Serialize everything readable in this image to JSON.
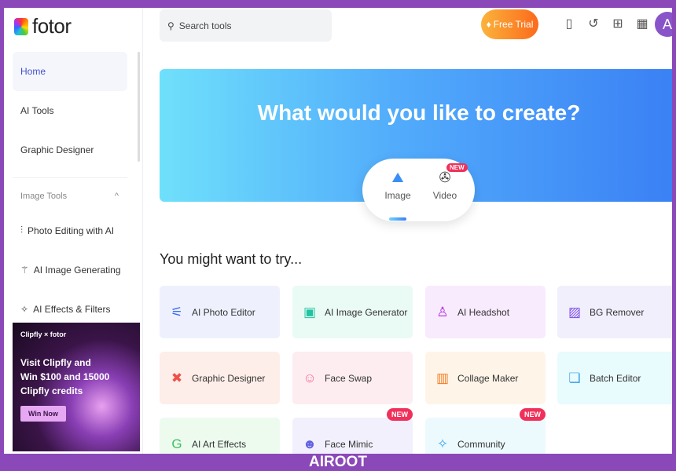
{
  "logo": "fotor",
  "sidebar": {
    "items": [
      {
        "label": "Home",
        "active": true
      },
      {
        "label": "AI Tools"
      },
      {
        "label": "Graphic Designer"
      }
    ],
    "section": "Image Tools",
    "sub_items": [
      {
        "label": "Photo Editing with AI",
        "icon": "sliders-icon"
      },
      {
        "label": "AI Image Generating",
        "icon": "magic-wand-icon"
      },
      {
        "label": "AI Effects & Filters",
        "icon": "effects-icon"
      }
    ],
    "banner": {
      "brand": "Clipfly × fotor",
      "line1": "Visit Clipfly and",
      "line2": "Win $100 and 15000",
      "line3": "Clipfly credits",
      "button": "Win Now"
    }
  },
  "header": {
    "search_placeholder": "Search tools",
    "free_trial": "Free Trial",
    "avatar": "A"
  },
  "hero": {
    "title": "What would you like to create?",
    "tabs": [
      {
        "label": "Image",
        "active": true
      },
      {
        "label": "Video",
        "badge": "NEW"
      }
    ]
  },
  "section_title": "You might want to try...",
  "cards": [
    {
      "label": "AI Photo Editor",
      "bg": "#eef1fd",
      "color": "#3b6cf0",
      "icon": "⚟"
    },
    {
      "label": "AI Image Generator",
      "bg": "#eafaf4",
      "color": "#22c3a0",
      "icon": "▣"
    },
    {
      "label": "AI Headshot",
      "bg": "#f8ebfd",
      "color": "#b22ee0",
      "icon": "♙"
    },
    {
      "label": "BG Remover",
      "bg": "#f1effc",
      "color": "#7c4ce8",
      "icon": "▨"
    },
    {
      "label": "Graphic Designer",
      "bg": "#fdeee9",
      "color": "#f0504a",
      "icon": "✖"
    },
    {
      "label": "Face Swap",
      "bg": "#fdedf0",
      "color": "#f06a90",
      "icon": "☺"
    },
    {
      "label": "Collage Maker",
      "bg": "#fef5e8",
      "color": "#f57a20",
      "icon": "▥"
    },
    {
      "label": "Batch Editor",
      "bg": "#e8fbfd",
      "color": "#3aa0e8",
      "icon": "❏"
    },
    {
      "label": "AI Art Effects",
      "bg": "#edfbef",
      "color": "#40c060",
      "icon": "G"
    },
    {
      "label": "Face Mimic",
      "bg": "#f1f0fc",
      "color": "#6060e0",
      "icon": "☻",
      "badge": "NEW"
    },
    {
      "label": "Community",
      "bg": "#edfafd",
      "color": "#40a8f0",
      "icon": "✧",
      "badge": "NEW"
    }
  ],
  "footer": "AIROOT"
}
